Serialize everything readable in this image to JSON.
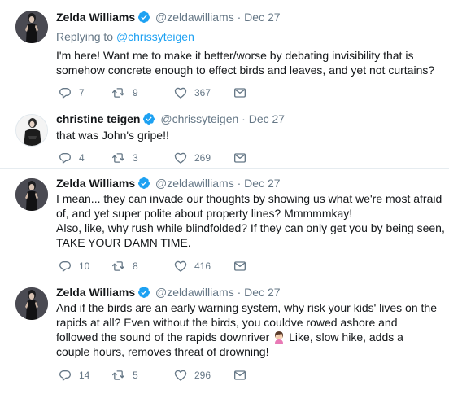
{
  "colors": {
    "text": "#14171a",
    "muted": "#657786",
    "link": "#1da1f2",
    "verified": "#1da1f2",
    "separator": "#e6ecf0"
  },
  "tweets": [
    {
      "name": "Zelda Williams",
      "handle": "@zeldawilliams",
      "dot": "·",
      "date": "Dec 27",
      "replying_prefix": "Replying to",
      "replying_handle": "@chrissyteigen",
      "lines": [
        "I'm here! Want me to make it better/worse by debating invisibility that is",
        "somehow concrete enough to effect birds and leaves, and yet not curtains?"
      ],
      "replies": "7",
      "retweets": "9",
      "likes": "367"
    },
    {
      "name": "christine teigen",
      "handle": "@chrissyteigen",
      "dot": "·",
      "date": "Dec 27",
      "lines": [
        "that was John's gripe!!"
      ],
      "replies": "4",
      "retweets": "3",
      "likes": "269"
    },
    {
      "name": "Zelda Williams",
      "handle": "@zeldawilliams",
      "dot": "·",
      "date": "Dec 27",
      "lines": [
        "I mean... they can invade our thoughts by showing us what we're most afraid",
        "of, and yet super polite about property lines? Mmmmmkay!",
        "Also, like, why rush while blindfolded? If they can only get you by being seen,",
        "TAKE YOUR DAMN TIME."
      ],
      "replies": "10",
      "retweets": "8",
      "likes": "416"
    },
    {
      "name": "Zelda Williams",
      "handle": "@zeldawilliams",
      "dot": "·",
      "date": "Dec 27",
      "lines": [
        "And if the birds are an early warning system, why risk your kids' lives on the",
        "rapids at all? Even without the birds, you couldve rowed ashore and",
        "followed the sound of the rapids downriver",
        "couple hours, removes threat of drowning!"
      ],
      "line3_suffix": "Like, slow hike, adds a",
      "emoji": "woman-facepalming-emoji",
      "replies": "14",
      "retweets": "5",
      "likes": "296"
    }
  ]
}
